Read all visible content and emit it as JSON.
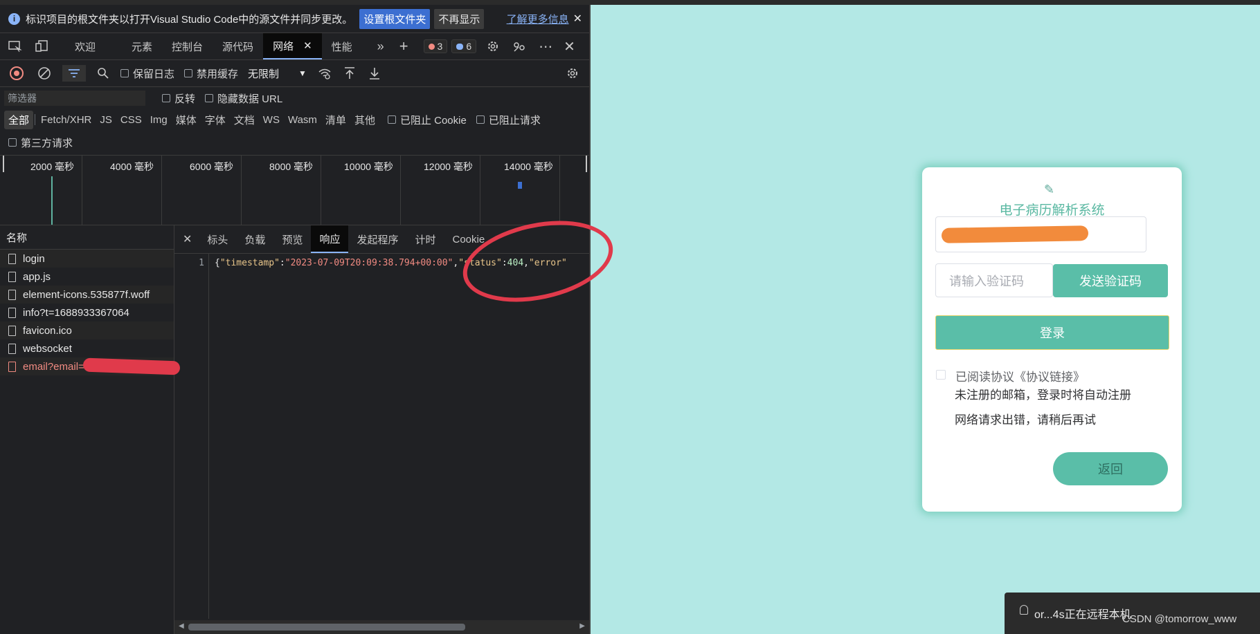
{
  "infobar": {
    "message": "标识项目的根文件夹以打开Visual Studio Code中的源文件并同步更改。",
    "set_root_label": "设置根文件夹",
    "dont_show_label": "不再显示",
    "learn_more_label": "了解更多信息"
  },
  "tabs": {
    "welcome": "欢迎",
    "elements": "元素",
    "console": "控制台",
    "sources": "源代码",
    "network": "网络",
    "performance": "性能",
    "error_count": "3",
    "message_count": "6"
  },
  "toolbar": {
    "preserve_log": "保留日志",
    "disable_cache": "禁用缓存",
    "throttle": "无限制"
  },
  "filter": {
    "placeholder": "筛选器",
    "invert": "反转",
    "hide_data_urls": "隐藏数据 URL"
  },
  "types": [
    "全部",
    "Fetch/XHR",
    "JS",
    "CSS",
    "Img",
    "媒体",
    "字体",
    "文档",
    "WS",
    "Wasm",
    "清单",
    "其他"
  ],
  "type_filters": {
    "blocked_cookies": "已阻止 Cookie",
    "blocked_requests": "已阻止请求",
    "third_party": "第三方请求"
  },
  "timeline": {
    "ticks": [
      "2000  毫秒",
      "4000  毫秒",
      "6000  毫秒",
      "8000  毫秒",
      "10000  毫秒",
      "12000  毫秒",
      "14000  毫秒"
    ]
  },
  "requests": {
    "header": "名称",
    "items": [
      "login",
      "app.js",
      "element-icons.535877f.woff",
      "info?t=1688933367064",
      "favicon.ico",
      "websocket",
      "email?email="
    ]
  },
  "detail": {
    "tabs": [
      "标头",
      "负载",
      "预览",
      "响应",
      "发起程序",
      "计时",
      "Cookie"
    ],
    "line_number": "1",
    "code": {
      "brace": "{",
      "k1": "\"timestamp\"",
      "colon1": ":",
      "v1": "\"2023-07-09T20:09:38.794+00:00\"",
      "comma1": ",",
      "k2": "\"status\"",
      "colon2": ":",
      "v2": "404",
      "comma2": ",",
      "k3": "\"error\""
    }
  },
  "login": {
    "title": "电子病历解析系统",
    "code_placeholder": "请输入验证码",
    "send_code_label": "发送验证码",
    "login_label": "登录",
    "agreement": "已阅读协议《协议链接》",
    "hint_unregistered": "未注册的邮箱，登录时将自动注册",
    "hint_error": "网络请求出错，请稍后再试",
    "back_label": "返回"
  },
  "taskbar": {
    "remote_text": "or...4s正在远程本机",
    "watermark": "CSDN @tomorrow_www"
  }
}
